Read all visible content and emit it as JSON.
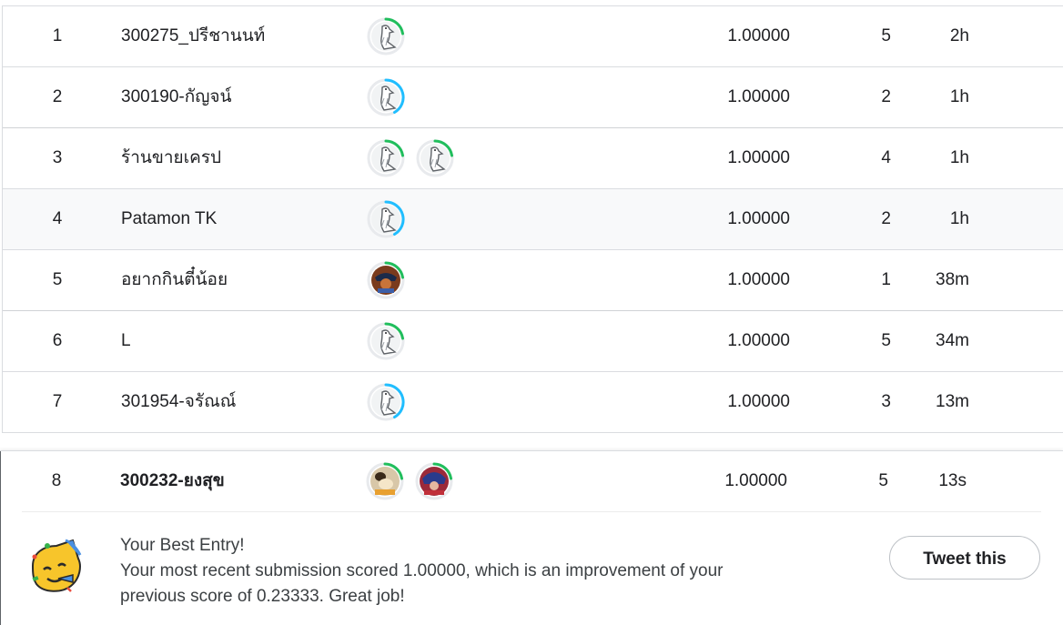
{
  "leaderboard": {
    "rows": [
      {
        "rank": "1",
        "team": "300275_ปรีชานนท์",
        "avatars": [
          {
            "kind": "goose",
            "ring": "green"
          }
        ],
        "score": "1.00000",
        "entries": "5",
        "last": "2h"
      },
      {
        "rank": "2",
        "team": "300190-กัญจน์",
        "avatars": [
          {
            "kind": "goose",
            "ring": "blue"
          }
        ],
        "score": "1.00000",
        "entries": "2",
        "last": "1h"
      },
      {
        "rank": "3",
        "team": "ร้านขายเครป",
        "avatars": [
          {
            "kind": "goose",
            "ring": "green"
          },
          {
            "kind": "goose",
            "ring": "green"
          }
        ],
        "score": "1.00000",
        "entries": "4",
        "last": "1h"
      },
      {
        "rank": "4",
        "team": "Patamon TK",
        "avatars": [
          {
            "kind": "goose",
            "ring": "blue"
          }
        ],
        "score": "1.00000",
        "entries": "2",
        "last": "1h"
      },
      {
        "rank": "5",
        "team": "อยากกินตี๋น้อย",
        "avatars": [
          {
            "kind": "photo-pirate",
            "ring": "green"
          }
        ],
        "score": "1.00000",
        "entries": "1",
        "last": "38m"
      },
      {
        "rank": "6",
        "team": "L",
        "avatars": [
          {
            "kind": "goose",
            "ring": "green"
          }
        ],
        "score": "1.00000",
        "entries": "5",
        "last": "34m"
      },
      {
        "rank": "7",
        "team": "301954-จรัณณ์",
        "avatars": [
          {
            "kind": "goose",
            "ring": "blue"
          }
        ],
        "score": "1.00000",
        "entries": "3",
        "last": "13m"
      }
    ],
    "your_row": {
      "rank": "8",
      "team": "300232-ยงสุข",
      "avatars": [
        {
          "kind": "photo-dog",
          "ring": "green"
        },
        {
          "kind": "photo-anime",
          "ring": "green"
        }
      ],
      "score": "1.00000",
      "entries": "5",
      "last": "13s"
    }
  },
  "best_entry": {
    "title": "Your Best Entry!",
    "message_line1": "Your most recent submission scored 1.00000, which is an improvement of your",
    "message_line2": "previous score of 0.23333. Great job!",
    "icon": "party-face-icon",
    "tweet_label": "Tweet this"
  },
  "colors": {
    "ring_green": "#20be5c",
    "ring_blue": "#20beff",
    "accent_text": "#202124"
  }
}
